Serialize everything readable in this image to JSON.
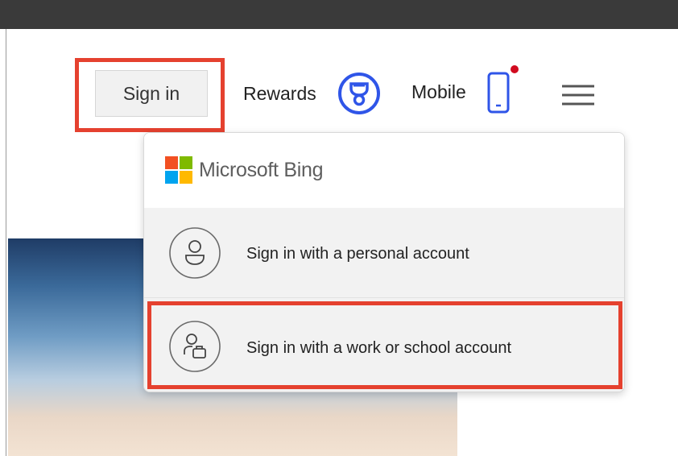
{
  "header": {
    "sign_in_label": "Sign in",
    "rewards_label": "Rewards",
    "mobile_label": "Mobile"
  },
  "flyout": {
    "brand": "Microsoft Bing",
    "options": [
      {
        "label": "Sign in with a personal account",
        "icon": "person-icon"
      },
      {
        "label": "Sign in with a work or school account",
        "icon": "work-account-icon"
      }
    ]
  },
  "colors": {
    "highlight": "#e5412f",
    "accent_blue": "#2f55e8",
    "notification": "#d10b1f"
  }
}
